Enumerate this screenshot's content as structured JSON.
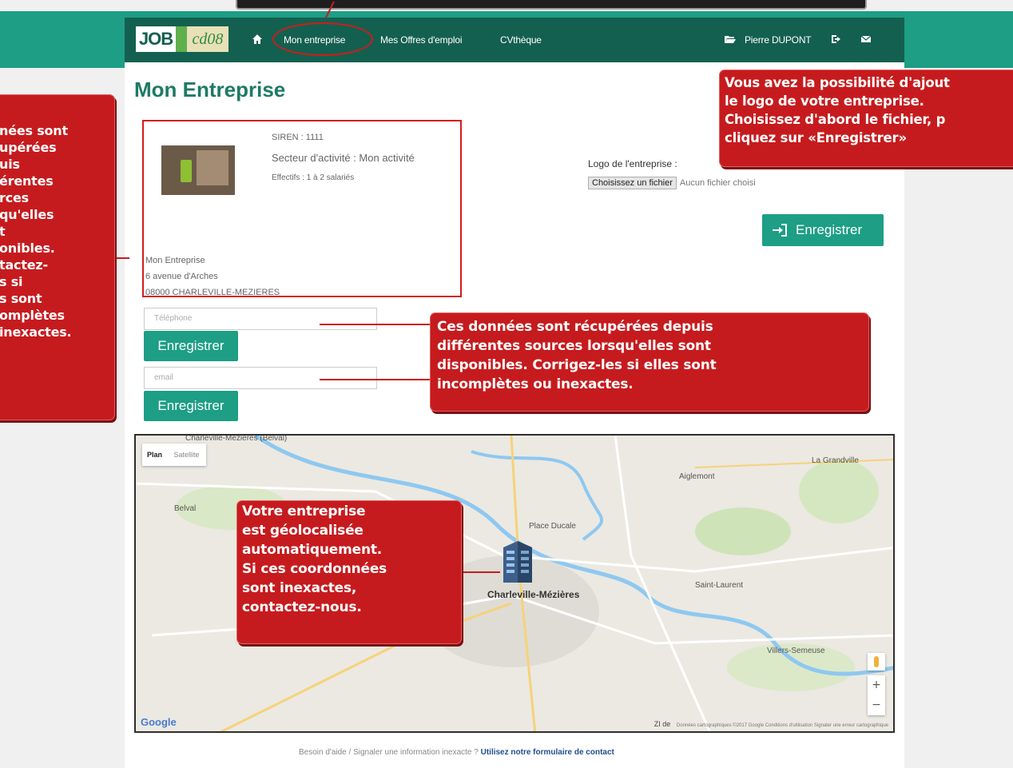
{
  "navbar": {
    "logo_job": "JOB",
    "logo_cd": "cd08",
    "items": [
      {
        "label": "Mon entreprise"
      },
      {
        "label": "Mes Offres d'emploi"
      },
      {
        "label": "CVthèque"
      }
    ],
    "user_name": "Pierre DUPONT"
  },
  "page": {
    "title": "Mon Entreprise"
  },
  "company": {
    "siren": "SIREN : 1111",
    "sector": "Secteur d'activité : Mon activité",
    "staff": "Effectifs : 1 à 2 salariés",
    "name": "Mon Entreprise",
    "street": "6 avenue d'Arches",
    "city": "08000 CHARLEVILLE-MEZIERES"
  },
  "logo_upload": {
    "label": "Logo de l'entreprise :",
    "file_button": "Choisissez un fichier",
    "file_status": "Aucun fichier choisi",
    "save_label": "Enregistrer"
  },
  "phone": {
    "placeholder": "Téléphone",
    "save_label": "Enregistrer"
  },
  "email": {
    "placeholder": "email",
    "save_label": "Enregistrer"
  },
  "map": {
    "toggle_plan": "Plan",
    "toggle_satellite": "Satellite",
    "city_label": "Charleville-Mézières",
    "labels": [
      "Charleville-Mézières (Belval)",
      "Belval",
      "Aiglemont",
      "La Grandville",
      "Saint-Laurent",
      "Villers-Semeuse",
      "Place Ducale"
    ],
    "google": "Google",
    "zoom_in": "+",
    "zoom_out": "−",
    "zone": "ZI de",
    "credits": "Données cartographiques ©2017 Google   Conditions d'utilisation   Signaler une erreur cartographique"
  },
  "footer": {
    "help_text": "Besoin d'aide / Signaler une information inexacte ? ",
    "contact_link": "Utilisez notre formulaire de contact"
  },
  "callouts": {
    "left": "nées sont\nupérées\nuis\nérentes\nrces\nqu'elles\nt\nonibles.\ntactez-\ns si\ns sont\nomplètes\ninexactes.",
    "right": " Vous avez la possibilité d'ajout\nle logo de votre entreprise.\nChoisissez d'abord le fichier, p\n cliquez sur «Enregistrer»",
    "mid": " Ces données sont récupérées depuis\ndifférentes sources lorsqu'elles sont\ndisponibles. Corrigez-les si elles sont\n incomplètes ou inexactes.",
    "map": " Votre entreprise\nest géolocalisée\nautomatiquement.\nSi ces coordonnées\nsont inexactes,\ncontactez-nous."
  },
  "colors": {
    "brand_teal": "#1d9e85",
    "navbar_dark": "#146050",
    "callout_red": "#c61b1e"
  }
}
